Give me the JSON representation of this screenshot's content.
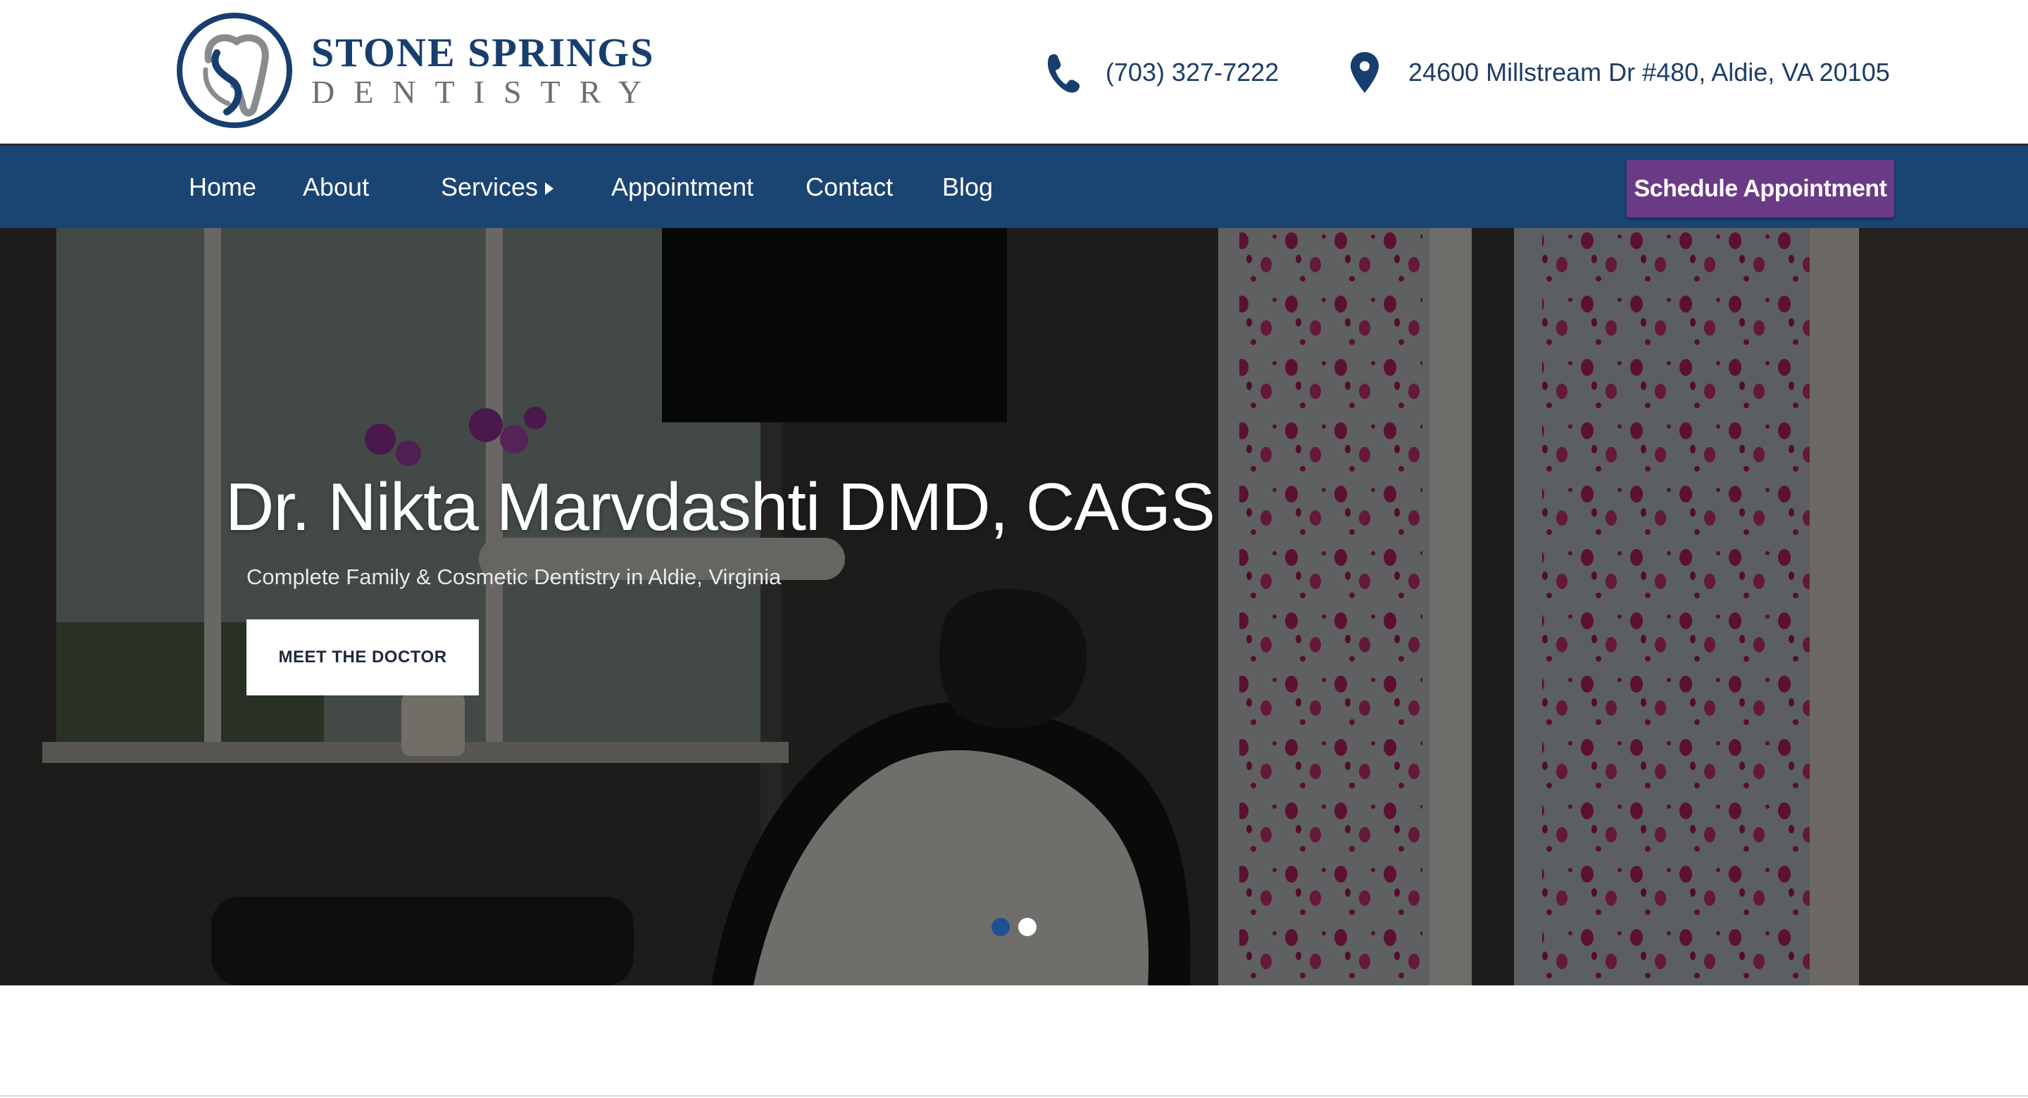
{
  "brand": {
    "name_line1": "STONE SPRINGS",
    "name_line2": "DENTISTRY",
    "primary_color": "#173e6e",
    "secondary_color": "#6d6e70"
  },
  "contact": {
    "phone_icon": "phone-icon",
    "phone": "(703) 327-7222",
    "address_icon": "map-pin-icon",
    "address": "24600 Millstream Dr #480, Aldie, VA 20105"
  },
  "nav": {
    "background": "#1a4472",
    "items": [
      {
        "label": "Home"
      },
      {
        "label": "About"
      },
      {
        "label": "Services",
        "has_submenu": true,
        "submenu_icon": "caret-right-icon"
      },
      {
        "label": "Appointment"
      },
      {
        "label": "Contact"
      },
      {
        "label": "Blog"
      }
    ],
    "cta_label": "Schedule Appointment",
    "cta_color": "#6b3a87"
  },
  "hero": {
    "title": "Dr. Nikta Marvdashti DMD, CAGS",
    "subtitle": "Complete Family & Cosmetic Dentistry in Aldie, Virginia",
    "button_label": "MEET THE DOCTOR",
    "slides_total": 2,
    "active_slide": 1,
    "dot_active_color": "#1e5192",
    "dot_inactive_color": "#ffffff"
  }
}
